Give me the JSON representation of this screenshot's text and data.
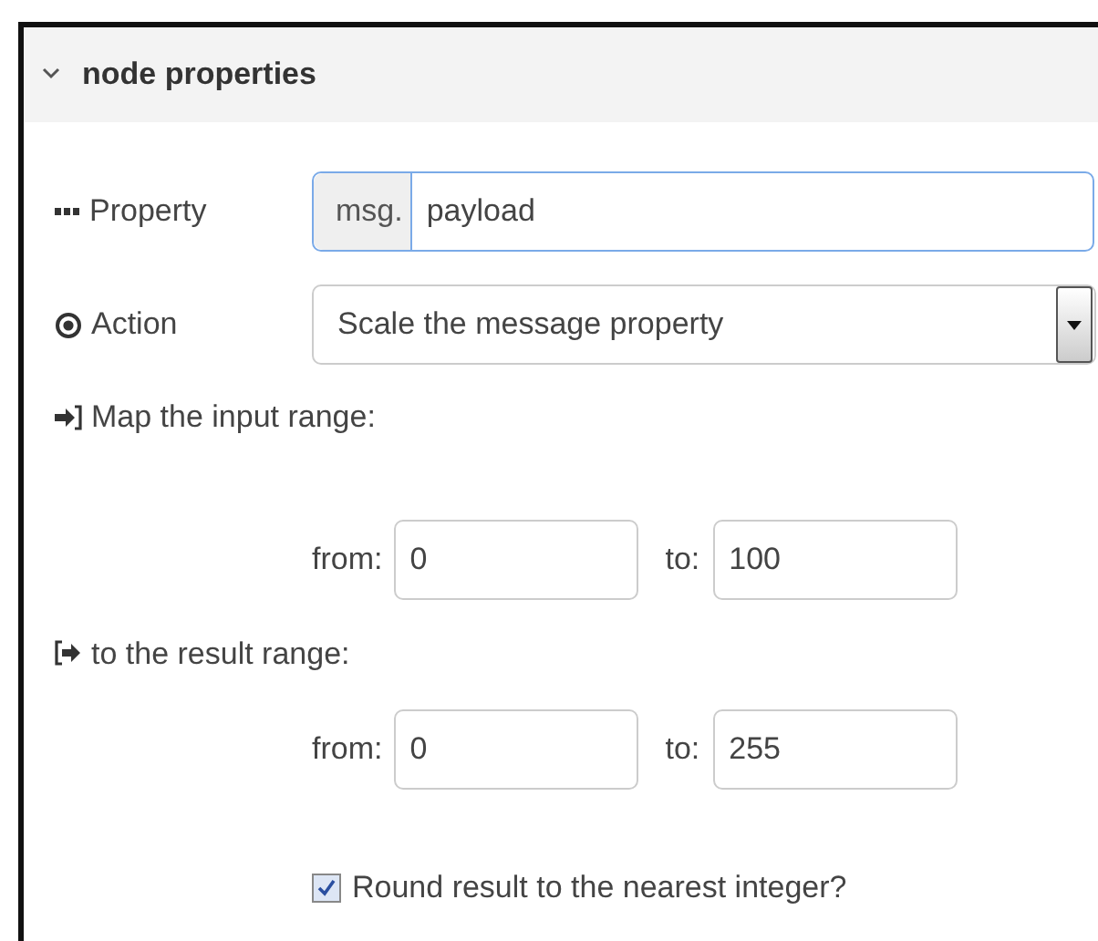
{
  "section": {
    "title": "node properties",
    "expanded": true
  },
  "property": {
    "label": "Property",
    "prefix": "msg.",
    "value": "payload"
  },
  "action": {
    "label": "Action",
    "value": "Scale the message property"
  },
  "ranges": [
    {
      "kind": "input",
      "label": "Map the input range:",
      "from_label": "from:",
      "from": "0",
      "to_label": "to:",
      "to": "100"
    },
    {
      "kind": "result",
      "label": "to the result range:",
      "from_label": "from:",
      "from": "0",
      "to_label": "to:",
      "to": "255"
    }
  ],
  "round": {
    "label": "Round result to the nearest integer?",
    "checked": true
  }
}
